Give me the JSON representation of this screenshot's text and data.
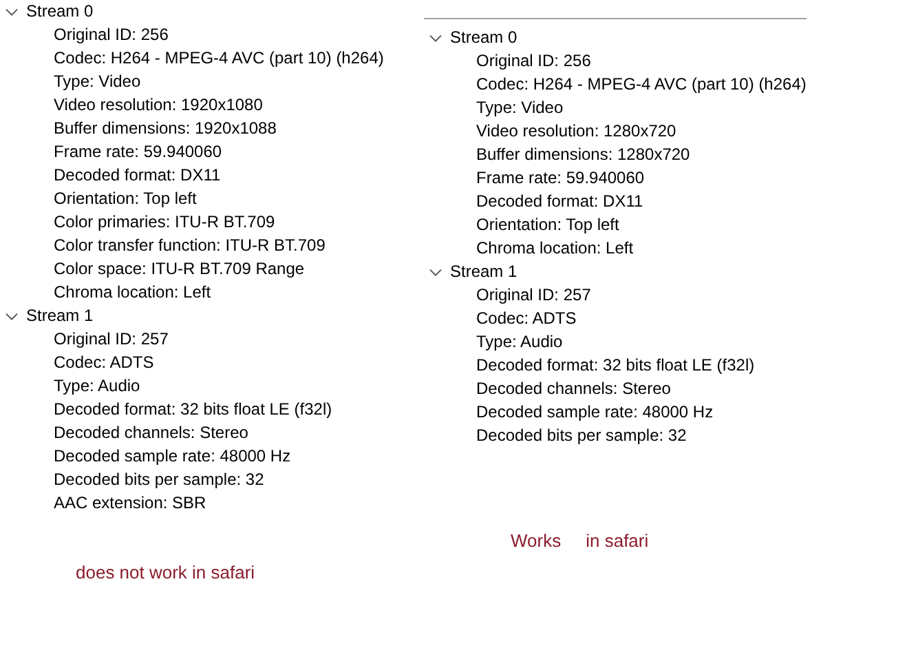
{
  "panels": [
    {
      "streams": [
        {
          "label": "Stream 0",
          "expanded": true,
          "properties": [
            "Original ID: 256",
            "Codec: H264 - MPEG-4 AVC (part 10) (h264)",
            "Type: Video",
            "Video resolution: 1920x1080",
            "Buffer dimensions: 1920x1088",
            "Frame rate: 59.940060",
            "Decoded format: DX11",
            "Orientation: Top left",
            "Color primaries: ITU-R BT.709",
            "Color transfer function: ITU-R BT.709",
            "Color space: ITU-R BT.709 Range",
            "Chroma location: Left"
          ]
        },
        {
          "label": "Stream 1",
          "expanded": true,
          "properties": [
            "Original ID: 257",
            "Codec: ADTS",
            "Type: Audio",
            "Decoded format: 32 bits float LE (f32l)",
            "Decoded channels: Stereo",
            "Decoded sample rate: 48000 Hz",
            "Decoded bits per sample: 32",
            "AAC extension: SBR"
          ]
        }
      ],
      "notes": [
        "does not work in safari"
      ]
    },
    {
      "streams": [
        {
          "label": "Stream 0",
          "expanded": true,
          "properties": [
            "Original ID: 256",
            "Codec: H264 - MPEG-4 AVC (part 10) (h264)",
            "Type: Video",
            "Video resolution: 1280x720",
            "Buffer dimensions: 1280x720",
            "Frame rate: 59.940060",
            "Decoded format: DX11",
            "Orientation: Top left",
            "Chroma location: Left"
          ]
        },
        {
          "label": "Stream 1",
          "expanded": true,
          "properties": [
            "Original ID: 257",
            "Codec: ADTS",
            "Type: Audio",
            "Decoded format: 32 bits float LE (f32l)",
            "Decoded channels: Stereo",
            "Decoded sample rate: 48000 Hz",
            "Decoded bits per sample: 32"
          ]
        }
      ],
      "notes": [
        "Works",
        "in safari"
      ]
    }
  ]
}
